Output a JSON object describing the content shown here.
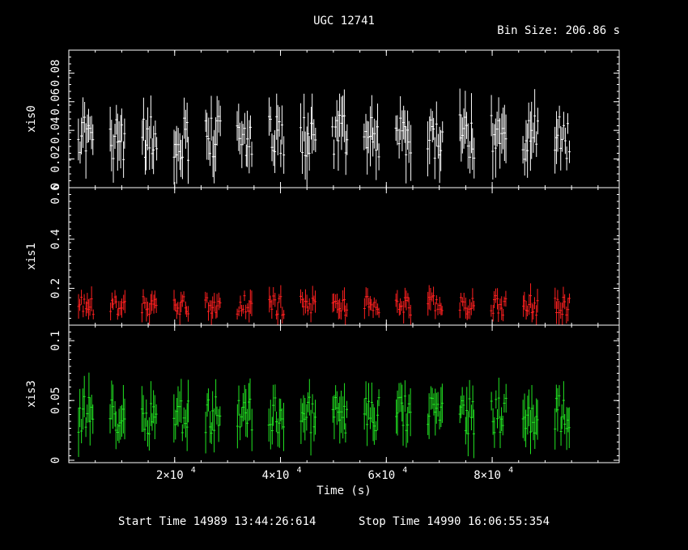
{
  "header": {
    "title": "UGC 12741",
    "bin_size": "Bin Size: 206.86 s"
  },
  "footer": {
    "start_time": "Start Time 14989 13:44:26:614",
    "stop_time": "Stop Time 14990 16:06:55:354"
  },
  "chart_data": {
    "type": "line",
    "xlabel": "Time (s)",
    "xlim": [
      0,
      104000
    ],
    "x_ticks": [
      20000,
      40000,
      60000,
      80000
    ],
    "x_tick_labels": [
      "2×10",
      "4×10",
      "6×10",
      "8×10"
    ],
    "x_tick_exponent": "4",
    "orbit_segments_start_s": [
      1800,
      7800,
      13800,
      19800,
      25800,
      31800,
      37800,
      43800,
      49800,
      55800,
      61800,
      67800,
      73800,
      79800,
      85800,
      91800
    ],
    "segment_length_s": 3000,
    "panels": [
      {
        "name": "xis0",
        "ylabel": "xis0",
        "color": "#ffffff",
        "ylim": [
          0,
          0.096
        ],
        "y_ticks": [
          0.02,
          0.04,
          0.06,
          0.08
        ],
        "y_tick_labels": [
          "0.02",
          "0.04",
          "0.06",
          "0.08"
        ],
        "bottom_tick_label": "0",
        "typical_rate": 0.035,
        "rate_spread": 0.02
      },
      {
        "name": "xis1",
        "ylabel": "xis1",
        "color": "#ff2020",
        "ylim": [
          0.05,
          0.61
        ],
        "y_ticks": [
          0.2,
          0.4
        ],
        "y_tick_labels": [
          "0.2",
          "0.4"
        ],
        "top_tick_label": "0.6",
        "typical_rate": 0.13,
        "rate_spread": 0.05
      },
      {
        "name": "xis3",
        "ylabel": "xis3",
        "color": "#22e622",
        "ylim": [
          -0.002,
          0.113
        ],
        "y_ticks": [
          0,
          0.05,
          0.1
        ],
        "y_tick_labels": [
          "0",
          "0.05",
          "0.1"
        ],
        "typical_rate": 0.038,
        "rate_spread": 0.02
      }
    ]
  }
}
